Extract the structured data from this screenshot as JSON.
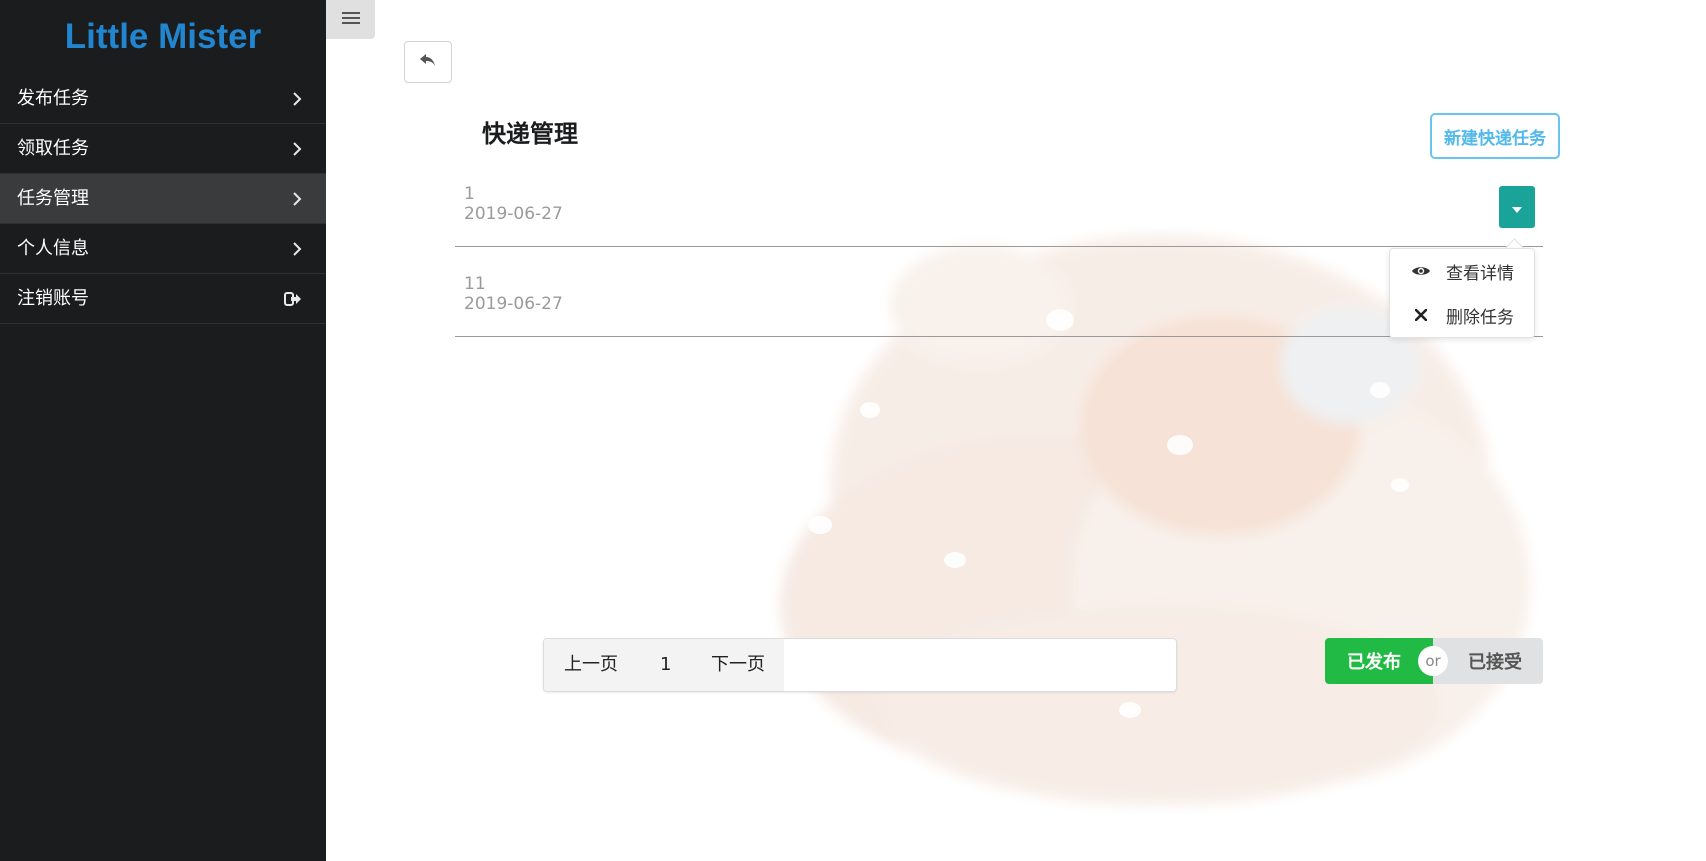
{
  "app": {
    "brand": "Little Mister"
  },
  "sidebar": {
    "items": [
      {
        "label": "发布任务",
        "icon": "chevron-right-icon"
      },
      {
        "label": "领取任务",
        "icon": "chevron-right-icon"
      },
      {
        "label": "任务管理",
        "icon": "chevron-right-icon",
        "active": true
      },
      {
        "label": "个人信息",
        "icon": "chevron-right-icon"
      },
      {
        "label": "注销账号",
        "icon": "sign-out-icon"
      }
    ]
  },
  "header": {
    "menu_icon": "hamburger-icon",
    "back_icon": "reply-icon"
  },
  "main": {
    "title": "快递管理",
    "new_button": "新建快递任务",
    "tasks": [
      {
        "number": "1",
        "date": "2019-06-27"
      },
      {
        "number": "11",
        "date": "2019-06-27"
      }
    ],
    "dropdown": {
      "icon": "caret-down-icon",
      "items": [
        {
          "label": "查看详情",
          "icon": "eye-icon"
        },
        {
          "label": "删除任务",
          "icon": "close-icon"
        }
      ]
    },
    "pagination": {
      "prev": "上一页",
      "current": "1",
      "next": "下一页"
    },
    "toggle": {
      "left": "已发布",
      "or": "or",
      "right": "已接受",
      "active": "left"
    }
  },
  "colors": {
    "brand": "#2185d0",
    "sidebar_bg": "#1b1c1d",
    "dropdown_teal": "#1aa398",
    "toggle_green": "#21ba45",
    "new_button_blue": "#52b9ea"
  }
}
